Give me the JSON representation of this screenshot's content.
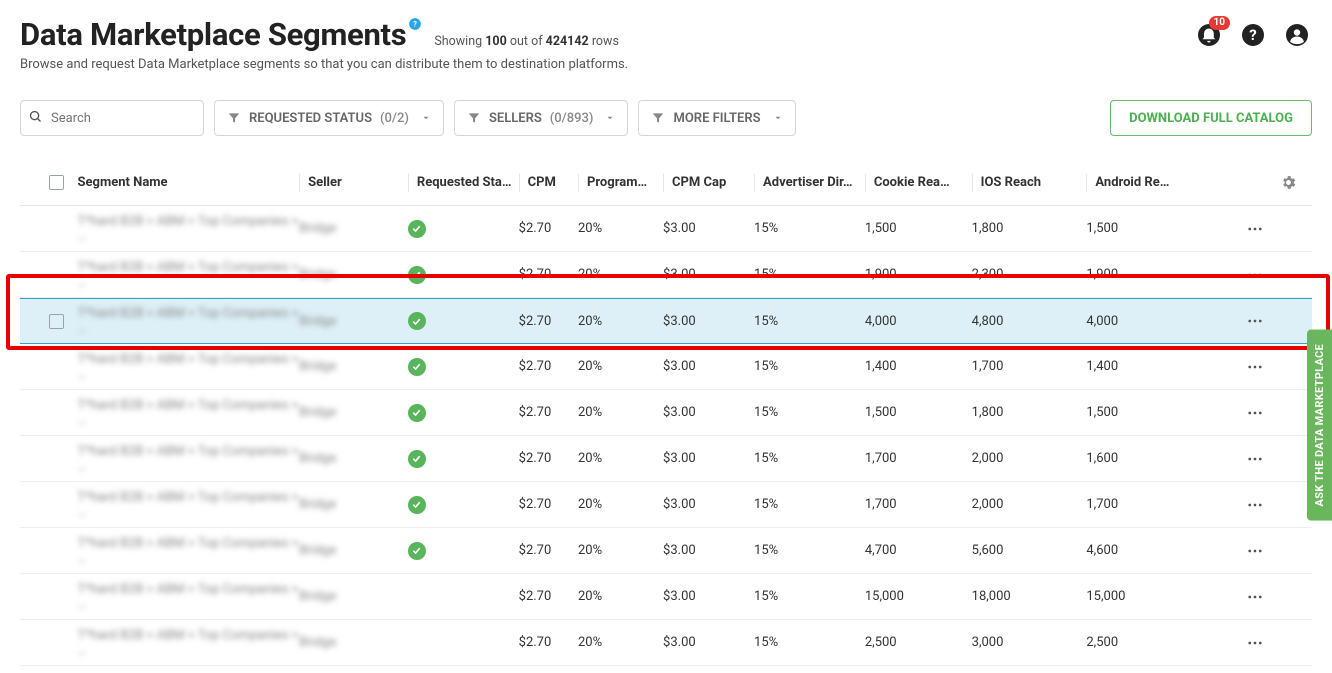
{
  "header": {
    "title": "Data Marketplace Segments",
    "showing_prefix": "Showing",
    "showing_count": "100",
    "showing_mid": "out of",
    "showing_total": "424142",
    "showing_suffix": "rows",
    "subtitle": "Browse and request Data Marketplace segments so that you can distribute them to destination platforms.",
    "notif_badge": "10"
  },
  "filters": {
    "search_placeholder": "Search",
    "requested_status_label": "REQUESTED STATUS",
    "requested_status_count": "(0/2)",
    "sellers_label": "SELLERS",
    "sellers_count": "(0/893)",
    "more_filters_label": "MORE FILTERS",
    "download_label": "DOWNLOAD FULL CATALOG"
  },
  "columns": {
    "segment_name": "Segment Name",
    "seller": "Seller",
    "requested_status": "Requested Sta…",
    "cpm": "CPM",
    "program": "Program…",
    "cpm_cap": "CPM Cap",
    "advertiser_dir": "Advertiser Dir…",
    "cookie_reach": "Cookie Rea…",
    "ios_reach": "IOS Reach",
    "android_reach": "Android Re…"
  },
  "rows": [
    {
      "segment_name": "T*hard B2B > ABM > Top Companies > …",
      "seller": "Bridge",
      "status": true,
      "cpm": "$2.70",
      "program": "20%",
      "cpm_cap": "$3.00",
      "adv_dir": "15%",
      "cookie": "1,500",
      "ios": "1,800",
      "android": "1,500",
      "hi": false
    },
    {
      "segment_name": "T*hard B2B > ABM > Top Companies > …",
      "seller": "Bridge",
      "status": true,
      "cpm": "$2.70",
      "program": "20%",
      "cpm_cap": "$3.00",
      "adv_dir": "15%",
      "cookie": "1,900",
      "ios": "2,300",
      "android": "1,900",
      "hi": false
    },
    {
      "segment_name": "T*hard B2B > ABM > Top Companies > …",
      "seller": "Bridge",
      "status": true,
      "cpm": "$2.70",
      "program": "20%",
      "cpm_cap": "$3.00",
      "adv_dir": "15%",
      "cookie": "4,000",
      "ios": "4,800",
      "android": "4,000",
      "hi": true
    },
    {
      "segment_name": "T*hard B2B > ABM > Top Companies > …",
      "seller": "Bridge",
      "status": true,
      "cpm": "$2.70",
      "program": "20%",
      "cpm_cap": "$3.00",
      "adv_dir": "15%",
      "cookie": "1,400",
      "ios": "1,700",
      "android": "1,400",
      "hi": false
    },
    {
      "segment_name": "T*hard B2B > ABM > Top Companies > …",
      "seller": "Bridge",
      "status": true,
      "cpm": "$2.70",
      "program": "20%",
      "cpm_cap": "$3.00",
      "adv_dir": "15%",
      "cookie": "1,500",
      "ios": "1,800",
      "android": "1,500",
      "hi": false
    },
    {
      "segment_name": "T*hard B2B > ABM > Top Companies > …",
      "seller": "Bridge",
      "status": true,
      "cpm": "$2.70",
      "program": "20%",
      "cpm_cap": "$3.00",
      "adv_dir": "15%",
      "cookie": "1,700",
      "ios": "2,000",
      "android": "1,600",
      "hi": false
    },
    {
      "segment_name": "T*hard B2B > ABM > Top Companies > …",
      "seller": "Bridge",
      "status": true,
      "cpm": "$2.70",
      "program": "20%",
      "cpm_cap": "$3.00",
      "adv_dir": "15%",
      "cookie": "1,700",
      "ios": "2,000",
      "android": "1,700",
      "hi": false
    },
    {
      "segment_name": "T*hard B2B > ABM > Top Companies > …",
      "seller": "Bridge",
      "status": true,
      "cpm": "$2.70",
      "program": "20%",
      "cpm_cap": "$3.00",
      "adv_dir": "15%",
      "cookie": "4,700",
      "ios": "5,600",
      "android": "4,600",
      "hi": false
    },
    {
      "segment_name": "T*hard B2B > ABM > Top Companies > …",
      "seller": "Bridge",
      "status": false,
      "cpm": "$2.70",
      "program": "20%",
      "cpm_cap": "$3.00",
      "adv_dir": "15%",
      "cookie": "15,000",
      "ios": "18,000",
      "android": "15,000",
      "hi": false
    },
    {
      "segment_name": "T*hard B2B > ABM > Top Companies > …",
      "seller": "Bridge",
      "status": false,
      "cpm": "$2.70",
      "program": "20%",
      "cpm_cap": "$3.00",
      "adv_dir": "15%",
      "cookie": "2,500",
      "ios": "3,000",
      "android": "2,500",
      "hi": false
    }
  ],
  "side_tab": "ASK THE DATA MARKETPLACE"
}
